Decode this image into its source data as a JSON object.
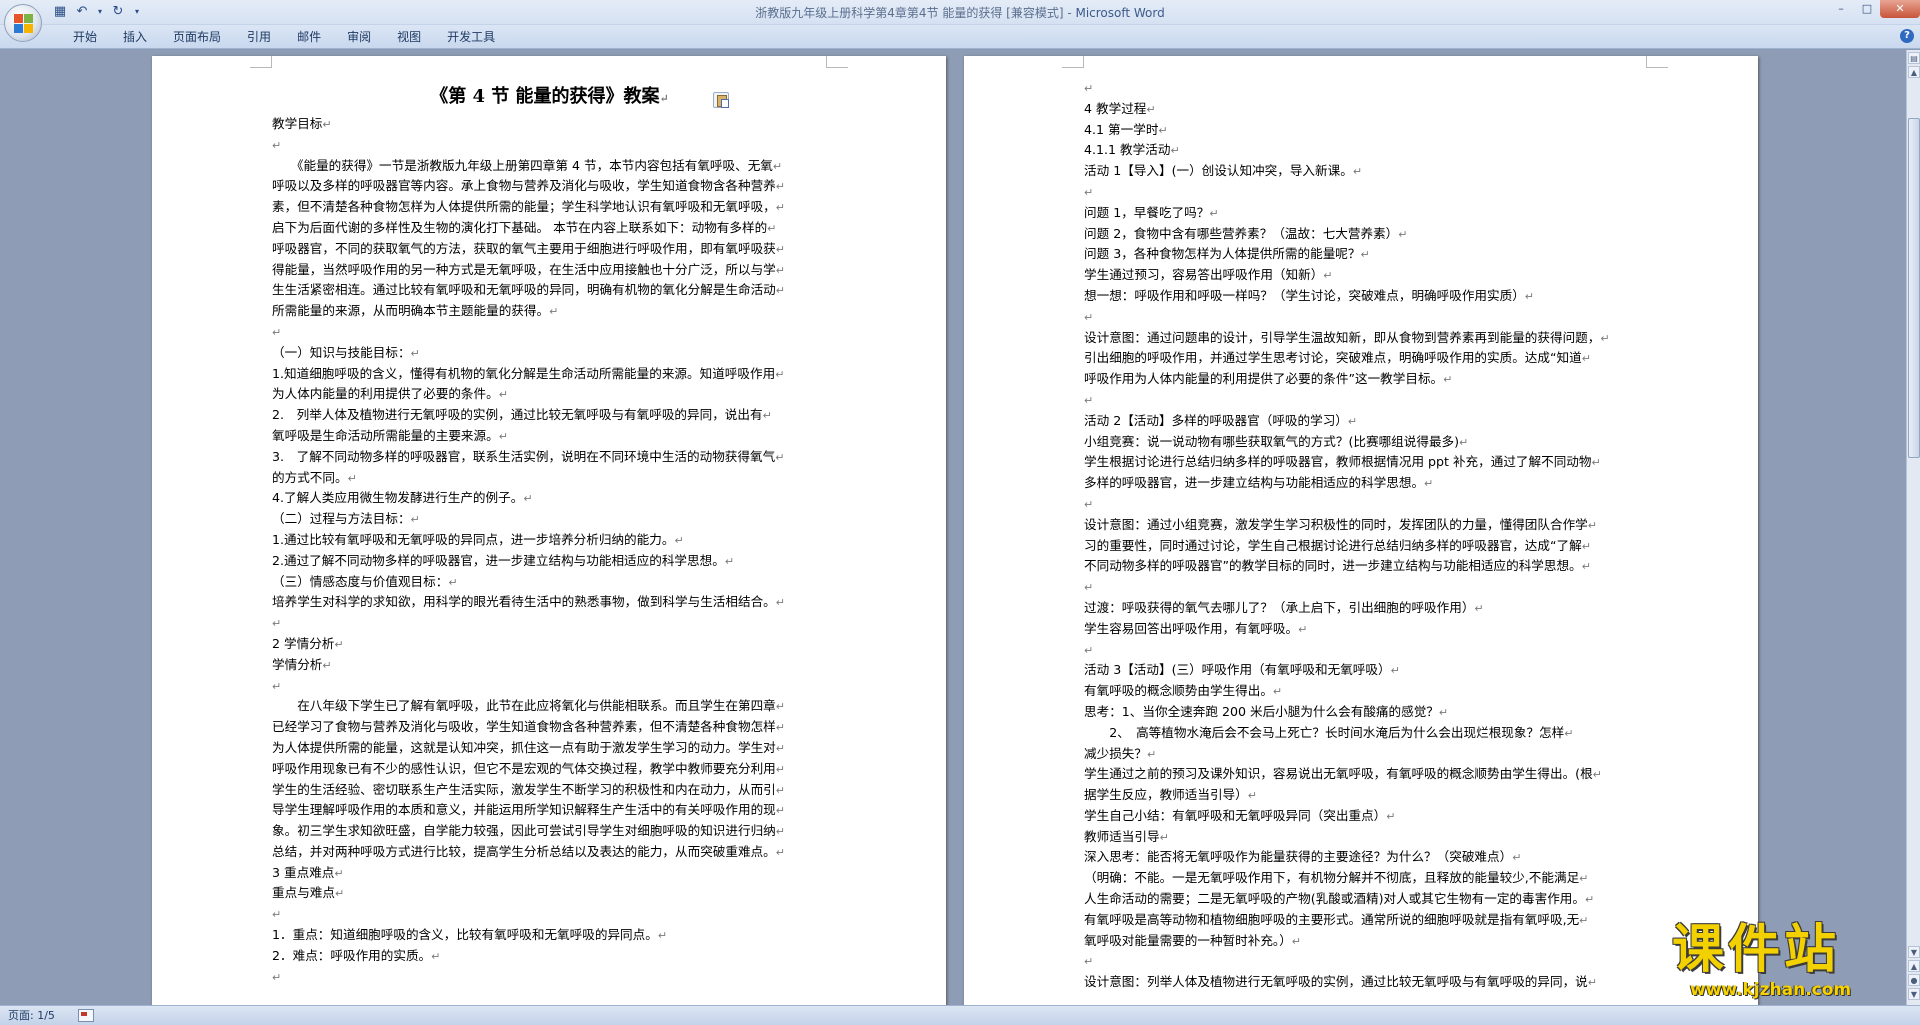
{
  "window": {
    "doc_title": "浙教版九年级上册科学第4章第4节 能量的获得 [兼容模式]",
    "separator": " - ",
    "app_name": "Microsoft Word"
  },
  "ribbon": {
    "tabs": [
      "开始",
      "插入",
      "页面布局",
      "引用",
      "邮件",
      "审阅",
      "视图",
      "开发工具"
    ]
  },
  "status": {
    "page_label": "页面: 1/5"
  },
  "watermark": {
    "main": "课件站",
    "url": "www.kjzhan.com"
  },
  "page1": {
    "title": "《第 4 节  能量的获得》教案",
    "lines": [
      "教学目标",
      "",
      "　　《能量的获得》一节是浙教版九年级上册第四章第 4 节，本节内容包括有氧呼吸、无氧",
      "呼吸以及多样的呼吸器官等内容。承上食物与营养及消化与吸收，学生知道食物含各种营养",
      "素，但不清楚各种食物怎样为人体提供所需的能量；学生科学地认识有氧呼吸和无氧呼吸，",
      "启下为后面代谢的多样性及生物的演化打下基础。 本节在内容上联系如下：动物有多样的",
      "呼吸器官，不同的获取氧气的方法，获取的氧气主要用于细胞进行呼吸作用，即有氧呼吸获",
      "得能量，当然呼吸作用的另一种方式是无氧呼吸，在生活中应用接触也十分广泛，所以与学",
      "生生活紧密相连。通过比较有氧呼吸和无氧呼吸的异同，明确有机物的氧化分解是生命活动",
      "所需能量的来源，从而明确本节主题能量的获得。",
      "",
      "（一）知识与技能目标：",
      "1.知道细胞呼吸的含义，懂得有机物的氧化分解是生命活动所需能量的来源。知道呼吸作用",
      "为人体内能量的利用提供了必要的条件。",
      "2.　列举人体及植物进行无氧呼吸的实例，通过比较无氧呼吸与有氧呼吸的异同，说出有",
      "氧呼吸是生命活动所需能量的主要来源。",
      "3.　了解不同动物多样的呼吸器官，联系生活实例，说明在不同环境中生活的动物获得氧气",
      "的方式不同。",
      "4.了解人类应用微生物发酵进行生产的例子。",
      "（二）过程与方法目标：",
      "1.通过比较有氧呼吸和无氧呼吸的异同点，进一步培养分析归纳的能力。",
      "2.通过了解不同动物多样的呼吸器官，进一步建立结构与功能相适应的科学思想。",
      "（三）情感态度与价值观目标：",
      "培养学生对科学的求知欲，用科学的眼光看待生活中的熟悉事物，做到科学与生活相结合。",
      "",
      "2 学情分析",
      "学情分析",
      "",
      "　　在八年级下学生已了解有氧呼吸，此节在此应将氧化与供能相联系。而且学生在第四章",
      "已经学习了食物与营养及消化与吸收，学生知道食物含各种营养素，但不清楚各种食物怎样",
      "为人体提供所需的能量，这就是认知冲突，抓住这一点有助于激发学生学习的动力。学生对",
      "呼吸作用现象已有不少的感性认识，但它不是宏观的气体交换过程，教学中教师要充分利用",
      "学生的生活经验、密切联系生产生活实际，激发学生不断学习的积极性和内在动力，从而引",
      "导学生理解呼吸作用的本质和意义，并能运用所学知识解释生产生活中的有关呼吸作用的现",
      "象。初三学生求知欲旺盛，自学能力较强，因此可尝试引导学生对细胞呼吸的知识进行归纳",
      "总结，并对两种呼吸方式进行比较，提高学生分析总结以及表达的能力，从而突破重难点。",
      "3 重点难点",
      "重点与难点",
      "",
      "1．重点：知道细胞呼吸的含义，比较有氧呼吸和无氧呼吸的异同点。",
      "2．难点：呼吸作用的实质。",
      ""
    ]
  },
  "page2": {
    "lines": [
      "",
      "4 教学过程",
      "4.1 第一学时",
      "4.1.1 教学活动",
      "活动 1【导入】(一）创设认知冲突，导入新课。",
      "",
      "问题 1，早餐吃了吗？",
      "问题 2，食物中含有哪些营养素？（温故：七大营养素）",
      "问题 3，各种食物怎样为人体提供所需的能量呢？",
      "学生通过预习，容易答出呼吸作用（知新）",
      "想一想：呼吸作用和呼吸一样吗？（学生讨论，突破难点，明确呼吸作用实质）",
      "",
      "设计意图：通过问题串的设计，引导学生温故知新，即从食物到营养素再到能量的获得问题，",
      "引出细胞的呼吸作用，并通过学生思考讨论，突破难点，明确呼吸作用的实质。达成“知道",
      "呼吸作用为人体内能量的利用提供了必要的条件”这一教学目标。",
      "",
      "活动 2【活动】多样的呼吸器官（呼吸的学习）",
      "小组竞赛：说一说动物有哪些获取氧气的方式？(比赛哪组说得最多)",
      "学生根据讨论进行总结归纳多样的呼吸器官，教师根据情况用 ppt 补充，通过了解不同动物",
      "多样的呼吸器官，进一步建立结构与功能相适应的科学思想。",
      "",
      "设计意图：通过小组竞赛，激发学生学习积极性的同时，发挥团队的力量，懂得团队合作学",
      "习的重要性，同时通过讨论，学生自己根据讨论进行总结归纳多样的呼吸器官，达成“了解",
      "不同动物多样的呼吸器官”的教学目标的同时，进一步建立结构与功能相适应的科学思想。",
      "",
      "过渡：呼吸获得的氧气去哪儿了？（承上启下，引出细胞的呼吸作用）",
      "学生容易回答出呼吸作用，有氧呼吸。",
      "",
      "活动 3【活动】(三）呼吸作用（有氧呼吸和无氧呼吸）",
      "有氧呼吸的概念顺势由学生得出。",
      "思考：1、当你全速奔跑 200 米后小腿为什么会有酸痛的感觉？",
      "　　2、　高等植物水淹后会不会马上死亡？长时间水淹后为什么会出现烂根现象？怎样",
      "减少损失？",
      "学生通过之前的预习及课外知识，容易说出无氧呼吸，有氧呼吸的概念顺势由学生得出。(根",
      "据学生反应，教师适当引导）",
      "学生自己小结：有氧呼吸和无氧呼吸异同（突出重点）",
      "教师适当引导",
      "深入思考：能否将无氧呼吸作为能量获得的主要途径？为什么？（突破难点）",
      "（明确：不能。一是无氧呼吸作用下，有机物分解并不彻底，且释放的能量较少,不能满足",
      "人生命活动的需要；二是无氧呼吸的产物(乳酸或酒精)对人或其它生物有一定的毒害作用。",
      "有氧呼吸是高等动物和植物细胞呼吸的主要形式。通常所说的细胞呼吸就是指有氧呼吸,无",
      "氧呼吸对能量需要的一种暂时补充。）",
      "",
      "设计意图：列举人体及植物进行无氧呼吸的实例，通过比较无氧呼吸与有氧呼吸的异同，说"
    ]
  }
}
